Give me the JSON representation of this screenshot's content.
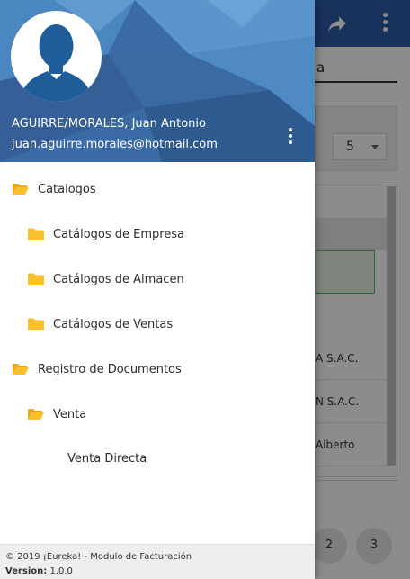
{
  "background": {
    "search_value": "a",
    "page_size": "5",
    "rows": [
      "A S.A.C.",
      "N S.A.C.",
      "Alberto"
    ],
    "pages": [
      "2",
      "3"
    ]
  },
  "drawer": {
    "user": {
      "name": "AGUIRRE/MORALES, Juan Antonio",
      "email": "juan.aguirre.morales@hotmail.com"
    },
    "menu": [
      {
        "label": "Catalogos",
        "icon": "folder-open-icon"
      },
      {
        "label": "Catálogos de Empresa",
        "icon": "folder-icon"
      },
      {
        "label": "Catálogos de Almacen",
        "icon": "folder-icon"
      },
      {
        "label": "Catálogos de Ventas",
        "icon": "folder-icon"
      },
      {
        "label": "Registro de Documentos",
        "icon": "folder-open-icon"
      },
      {
        "label": "Venta",
        "icon": "folder-open-icon"
      },
      {
        "label": "Venta Directa",
        "icon": ""
      }
    ],
    "footer": {
      "copyright": "© 2019 ¡Eureka! - Modulo de Facturación",
      "version_label": "Version:",
      "version_value": "1.0.0"
    }
  },
  "colors": {
    "topbar": "#2e5ca6",
    "header": "#3e6fa8",
    "folder": "#f9c02d",
    "avatar_silhouette": "#1e5d9a"
  }
}
